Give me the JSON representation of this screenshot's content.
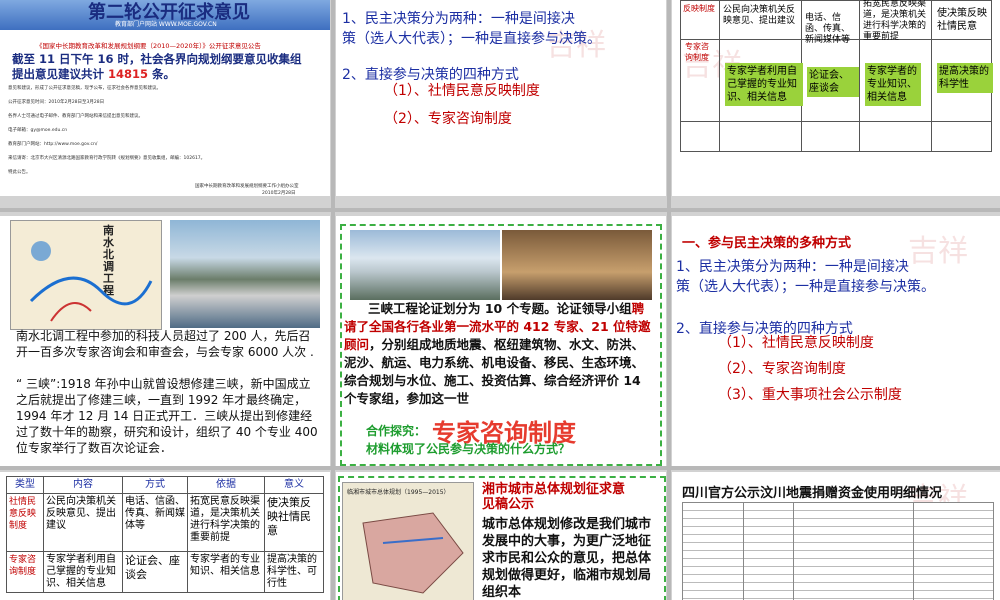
{
  "s1": {
    "banner": "第二轮公开征求意见",
    "url": "教育部门户网站 WWW.MOE.GOV.CN",
    "doc_title": "《国家中长期教育改革和发展规划纲要（2010—2020年）》公开征求意见公告",
    "highlight_a": "截至 11 日下午 16 时，社会各界向规划纲要意见收集组",
    "highlight_b": "提出意见建议共计 ",
    "highlight_num": "14815",
    "highlight_c": " 条。",
    "small_lines": [
      "意见和建议，形成了公开征求意见稿，现予公布，征求社会各界意见和建议。",
      "公开征求意见时间：2010年2月28日至3月28日",
      "各界人士可通过电子邮件、教育部门户网站和来信提出意见和建议。",
      "电子邮箱：gy@moe.edu.cn",
      "教育部门户网站：http://www.moe.gov.cn/",
      "来信请寄：北京市大兴区清源北路国家教育行政学院转《规划纲要》意见收集组，邮编：102617。",
      "特此公告。"
    ],
    "sign1": "国家中长期教育改革和发展规划纲要工作小组办公室",
    "sign2": "2010年2月28日"
  },
  "s2": {
    "l1a": "1、民主决策分为两种：一种是间接决",
    "l1b": "策（选人大代表）；一种是直接参与决策。",
    "l2": "2、直接参与决策的四种方式",
    "i1": "（1）、社情民意反映制度",
    "i2": "（2）、专家咨询制度"
  },
  "s3": {
    "left1": "反映制度",
    "c1": "公民向决策机关反映意见、提出建议",
    "c2": "电话、信函、传真、新闻媒体等",
    "c3": "拓宽民意反映渠道，是决策机关进行科学决策的重要前提",
    "c4": "使决策反映社情民意",
    "left2": "专家咨询制度",
    "g1": "专家学者利用自己掌握的专业知识、相关信息",
    "g2": "论证会、座谈会",
    "g3": "专家学者的专业知识、相关信息",
    "g4": "提高决策的科学性"
  },
  "s4": {
    "map_title": "南水北调工程",
    "p1": "南水北调工程中参加的科技人员超过了 200 人，先后召开一百多次专家咨询会和审查会，与会专家 6000 人次 .",
    "p2": "“ 三峡”:1918 年孙中山就曾设想修建三峡，新中国成立之后就提出了修建三峡，一直到 1992 年才最终确定，1994 年才 12 月 14 日正式开工．三峡从提出到修建经过了数十年的勘察，研究和设计，组织了 40 个专业 400 位专家举行了数百次论证会．"
  },
  "s5": {
    "p_a": "三峡工程论证划分为 10 个专题。论证领导小组",
    "p_red": "聘请了全国各行各业第一流水平的 412 专家、21 位特邀顾问",
    "p_b": "，分别组成地质地震、枢纽建筑物、水文、防洪、泥沙、航运、电力系统、机电设备、移民、生态环境、综合规划与水位、施工、投资估算、综合经济评价 14 个专家组，参加这一世",
    "coop": "合作探究：",
    "big": "专家咨询制度",
    "question": "材料体现了公民参与决策的什么方式？"
  },
  "s6": {
    "heading": "一、参与民主决策的多种方式",
    "l1a": "1、民主决策分为两种：一种是间接决",
    "l1b": "策（选人大代表）；一种是直接参与决策。",
    "l2": "2、直接参与决策的四种方式",
    "i1": "（1）、社情民意反映制度",
    "i2": "（2）、专家咨询制度",
    "i3": "（3）、重大事项社会公示制度"
  },
  "s7": {
    "headers": [
      "类型",
      "内容",
      "方式",
      "依据",
      "意义"
    ],
    "r1": [
      "社情民意反映制度",
      "公民向决策机关反映意见、提出建议",
      "电话、信函、传真、新闻媒体等",
      "拓宽民意反映渠道，是决策机关进行科学决策的重要前提",
      "使决策反映社情民意"
    ],
    "r2": [
      "专家咨询制度",
      "专家学者利用自己掌握的专业知识、相关信息",
      "论证会、座谈会",
      "专家学者的专业知识、相关信息",
      "提高决策的科学性、可行性"
    ]
  },
  "s8": {
    "map_caption": "临湘市城市总体规划（1995—2015）",
    "title": "湘市城市总体规划征求意见稿公示",
    "body": "城市总体规划修改是我们城市发展中的大事，为更广泛地征求市民和公众的意见，把总体规划做得更好，临湘市规划局组织本"
  },
  "s9": {
    "title": "四川官方公示汶川地震捐赠资金使用明细情况"
  }
}
